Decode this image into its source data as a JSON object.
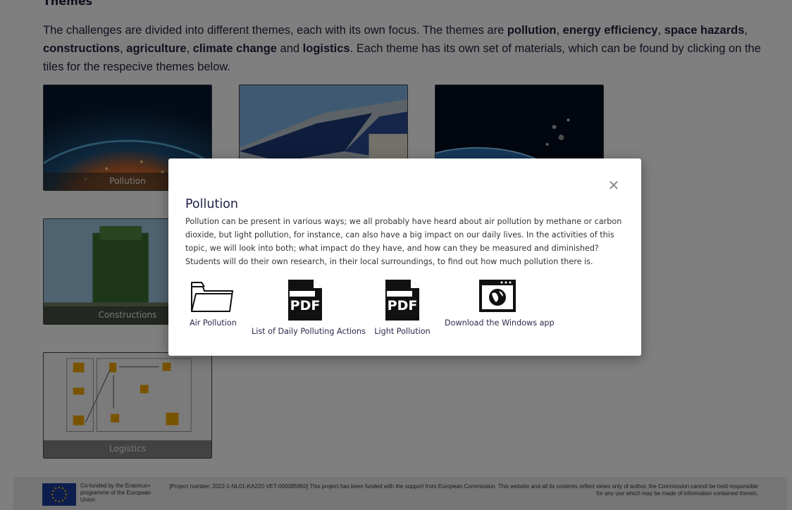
{
  "themes": {
    "heading": "Themes",
    "intro": [
      {
        "t": "The challenges are divided into different themes, each with its own focus. The themes are ",
        "b": false
      },
      {
        "t": "pollution",
        "b": true
      },
      {
        "t": ", ",
        "b": false
      },
      {
        "t": "energy efficiency",
        "b": true
      },
      {
        "t": ", ",
        "b": false
      },
      {
        "t": "space hazards",
        "b": true
      },
      {
        "t": ", ",
        "b": false
      },
      {
        "t": "constructions",
        "b": true
      },
      {
        "t": ", ",
        "b": false
      },
      {
        "t": "agriculture",
        "b": true
      },
      {
        "t": ", ",
        "b": false
      },
      {
        "t": "climate change",
        "b": true
      },
      {
        "t": " and ",
        "b": false
      },
      {
        "t": "logistics",
        "b": true
      },
      {
        "t": ". Each theme has its own set of materials, which can be found by clicking on the tiles for the respecive themes below.",
        "b": false
      }
    ],
    "tiles": [
      {
        "label": "Pollution",
        "image": "earth-night-lights"
      },
      {
        "label": "",
        "image": "solar-panels-roof"
      },
      {
        "label": "",
        "image": "space-debris-earth"
      },
      {
        "label": "Constructions",
        "image": "green-vertical-building"
      },
      {
        "label": "Logistics",
        "image": "logistics-flow-diagram"
      }
    ]
  },
  "modal": {
    "close_icon": "close-icon",
    "title": "Pollution",
    "description": "Pollution can be present in various ways; we all probably have heard about air pollution by methane or carbon dioxide, but light pollution, for instance, can also have a big impact on our daily lives. In the activities of this topic, we will look into both; what impact do they have, and how can they be measured and diminished? Students will do their own research, in their local surroundings, to find out how much pollution there is.",
    "resources": [
      {
        "label": "Air Pollution",
        "icon": "folder-icon"
      },
      {
        "label": "List of Daily Polluting Actions",
        "icon": "pdf-icon",
        "icon_text": "PDF"
      },
      {
        "label": "Light Pollution",
        "icon": "pdf-icon",
        "icon_text": "PDF"
      },
      {
        "label": "Download the Windows app",
        "icon": "windows-app-icon"
      }
    ]
  },
  "footer": {
    "cofunded": "Co-funded by the Erasmus+ programme of the European Union",
    "disclaimer": "[Project number: 2022-1-NL01-KA220-VET-000085960] This project has been funded with the support from European Commission. This website and all its contents reflect views only of author, the Commission cannot be held responsible for any use which may be made of information contained therein."
  },
  "colors": {
    "overlay": "#000000",
    "text_dark": "#22223f",
    "footer_bg": "#ececec",
    "eu_blue": "#1a3d9c",
    "eu_star": "#ffcc00"
  }
}
